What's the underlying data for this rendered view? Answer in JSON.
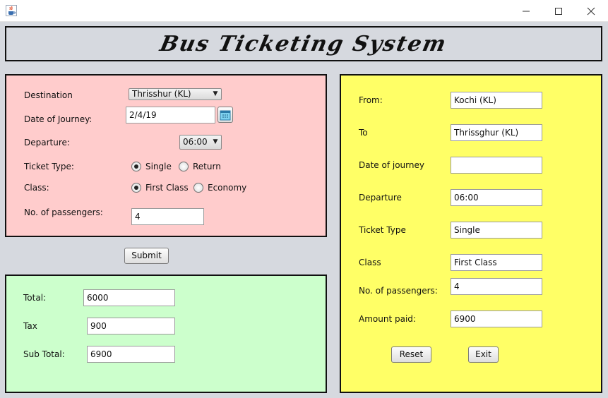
{
  "window": {
    "icon": "java-cup-icon",
    "controls": {
      "minimize": "minimize-icon",
      "maximize": "maximize-icon",
      "close": "close-icon"
    }
  },
  "header": {
    "title": "Bus Ticketing System"
  },
  "booking": {
    "destination_label": "Destination",
    "destination_value": "Thrisshur (KL)",
    "date_label": "Date of Journey:",
    "date_value": "2/4/19",
    "departure_label": "Departure:",
    "departure_value": "06:00",
    "ticket_type_label": "Ticket Type:",
    "ticket_type_options": [
      "Single",
      "Return"
    ],
    "ticket_type_selected": "Single",
    "class_label": "Class:",
    "class_options": [
      "First Class",
      "Economy"
    ],
    "class_selected": "First Class",
    "passengers_label": "No. of passengers:",
    "passengers_value": "4"
  },
  "submit_label": "Submit",
  "totals": {
    "total_label": "Total:",
    "total_value": "6000",
    "tax_label": "Tax",
    "tax_value": "900",
    "subtotal_label": "Sub Total:",
    "subtotal_value": "6900"
  },
  "summary": {
    "from_label": "From:",
    "from_value": "Kochi (KL)",
    "to_label": "To",
    "to_value": "Thrissghur (KL)",
    "date_label": "Date of journey",
    "date_value": "",
    "departure_label": "Departure",
    "departure_value": "06:00",
    "ticket_type_label": "Ticket Type",
    "ticket_type_value": "Single",
    "class_label": "Class",
    "class_value": "First Class",
    "passengers_label": "No. of passengers:",
    "passengers_value": "4",
    "amount_label": "Amount paid:",
    "amount_value": "6900",
    "reset_label": "Reset",
    "exit_label": "Exit"
  },
  "colors": {
    "booking_bg": "#ffcccc",
    "totals_bg": "#ccffcc",
    "summary_bg": "#ffff66",
    "window_bg": "#d6d9df"
  }
}
